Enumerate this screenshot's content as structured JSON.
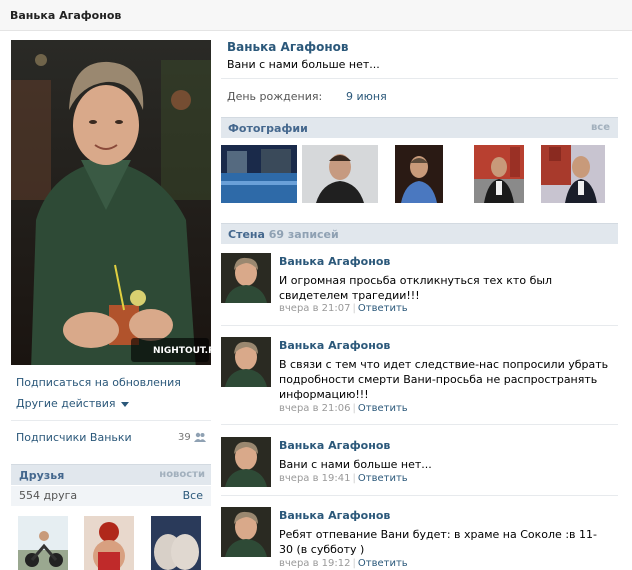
{
  "header": {
    "title": "Ванька Агафонов"
  },
  "left": {
    "avatar_watermark": "NIGHTOUT.RU",
    "subscribe": "Подписаться на обновления",
    "other_actions": "Другие действия",
    "followers_label": "Подписчики Ваньки",
    "followers_count": "39",
    "friends": {
      "title": "Друзья",
      "news": "новости",
      "count": "554 друга",
      "all": "Все"
    }
  },
  "profile": {
    "name": "Ванька Агафонов",
    "status": "Вани с нами больше нет...",
    "birthday_label": "День рождения:",
    "birthday_value": "9 июня"
  },
  "photos": {
    "title": "Фотографии",
    "all": "все"
  },
  "wall": {
    "title": "Стена",
    "count": "69 записей",
    "reply_label": "Ответить",
    "posts": [
      {
        "author": "Ванька Агафонов",
        "text": "И огромная просьба откликнуться тех кто был свидетелем трагедии!!!",
        "time": "вчера в 21:07"
      },
      {
        "author": "Ванька Агафонов",
        "text": "В связи с тем что идет следствие-нас попросили убрать подробности смерти Вани-просьба не распространять информацию!!!",
        "time": "вчера в 21:06"
      },
      {
        "author": "Ванька Агафонов",
        "text": "Вани с нами больше нет...",
        "time": "вчера в 19:41"
      },
      {
        "author": "Ванька Агафонов",
        "text": "Ребят отпевание Вани будет: в храме на Соколе :в 11-30 (в субботу )",
        "time": "вчера в 19:12"
      }
    ]
  },
  "colors": {
    "link": "#2b587a",
    "section_bg": "#e1e7ed",
    "section_title": "#45688e"
  },
  "icons": {
    "followers": "people-icon",
    "dropdown": "chevron-down-icon"
  }
}
